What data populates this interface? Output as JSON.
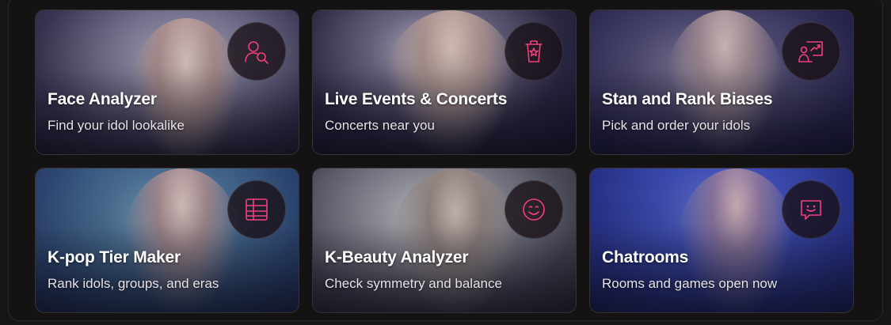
{
  "cards": [
    {
      "title": "Face Analyzer",
      "subtitle": "Find your idol lookalike",
      "icon": "face-search-icon"
    },
    {
      "title": "Live Events & Concerts",
      "subtitle": "Concerts near you",
      "icon": "ticket-star-icon"
    },
    {
      "title": "Stan and Rank Biases",
      "subtitle": "Pick and order your idols",
      "icon": "presentation-chart-icon"
    },
    {
      "title": "K-pop Tier Maker",
      "subtitle": "Rank idols, groups, and eras",
      "icon": "grid-table-icon"
    },
    {
      "title": "K-Beauty Analyzer",
      "subtitle": "Check symmetry and balance",
      "icon": "smiley-face-icon"
    },
    {
      "title": "Chatrooms",
      "subtitle": "Rooms and games open now",
      "icon": "chat-bubble-smile-icon"
    }
  ],
  "colors": {
    "accent": "#f0407c",
    "page_bg": "#171515",
    "title_text": "#ffffff",
    "subtitle_text": "#e4e2e6"
  }
}
